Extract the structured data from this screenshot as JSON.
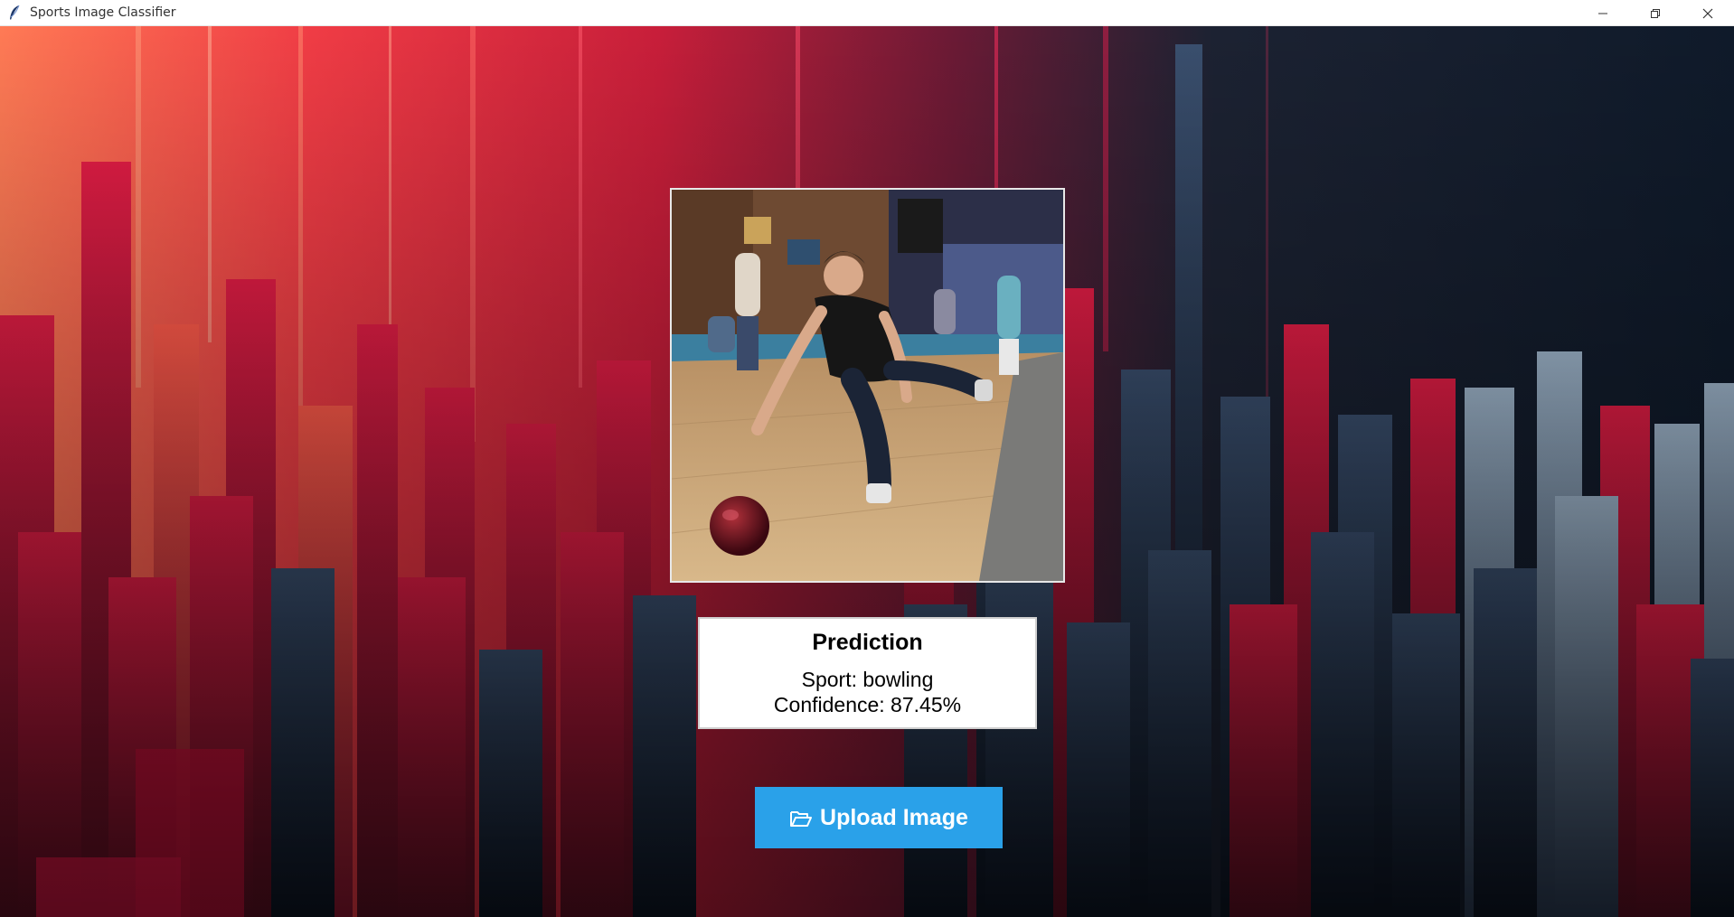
{
  "window": {
    "title": "Sports Image Classifier",
    "app_icon": "feather-icon",
    "controls": [
      "minimize-icon",
      "restore-icon",
      "close-icon"
    ]
  },
  "image_preview": {
    "description_icon": "bowling-photo"
  },
  "prediction": {
    "heading": "Prediction",
    "sport_line": "Sport: bowling",
    "confidence_line": "Confidence: 87.45%"
  },
  "upload": {
    "icon": "folder-open-icon",
    "label": "Upload Image"
  },
  "colors": {
    "button": "#2aa1e9",
    "background_warm": "#f03c45",
    "background_dark": "#0f1a2a"
  }
}
